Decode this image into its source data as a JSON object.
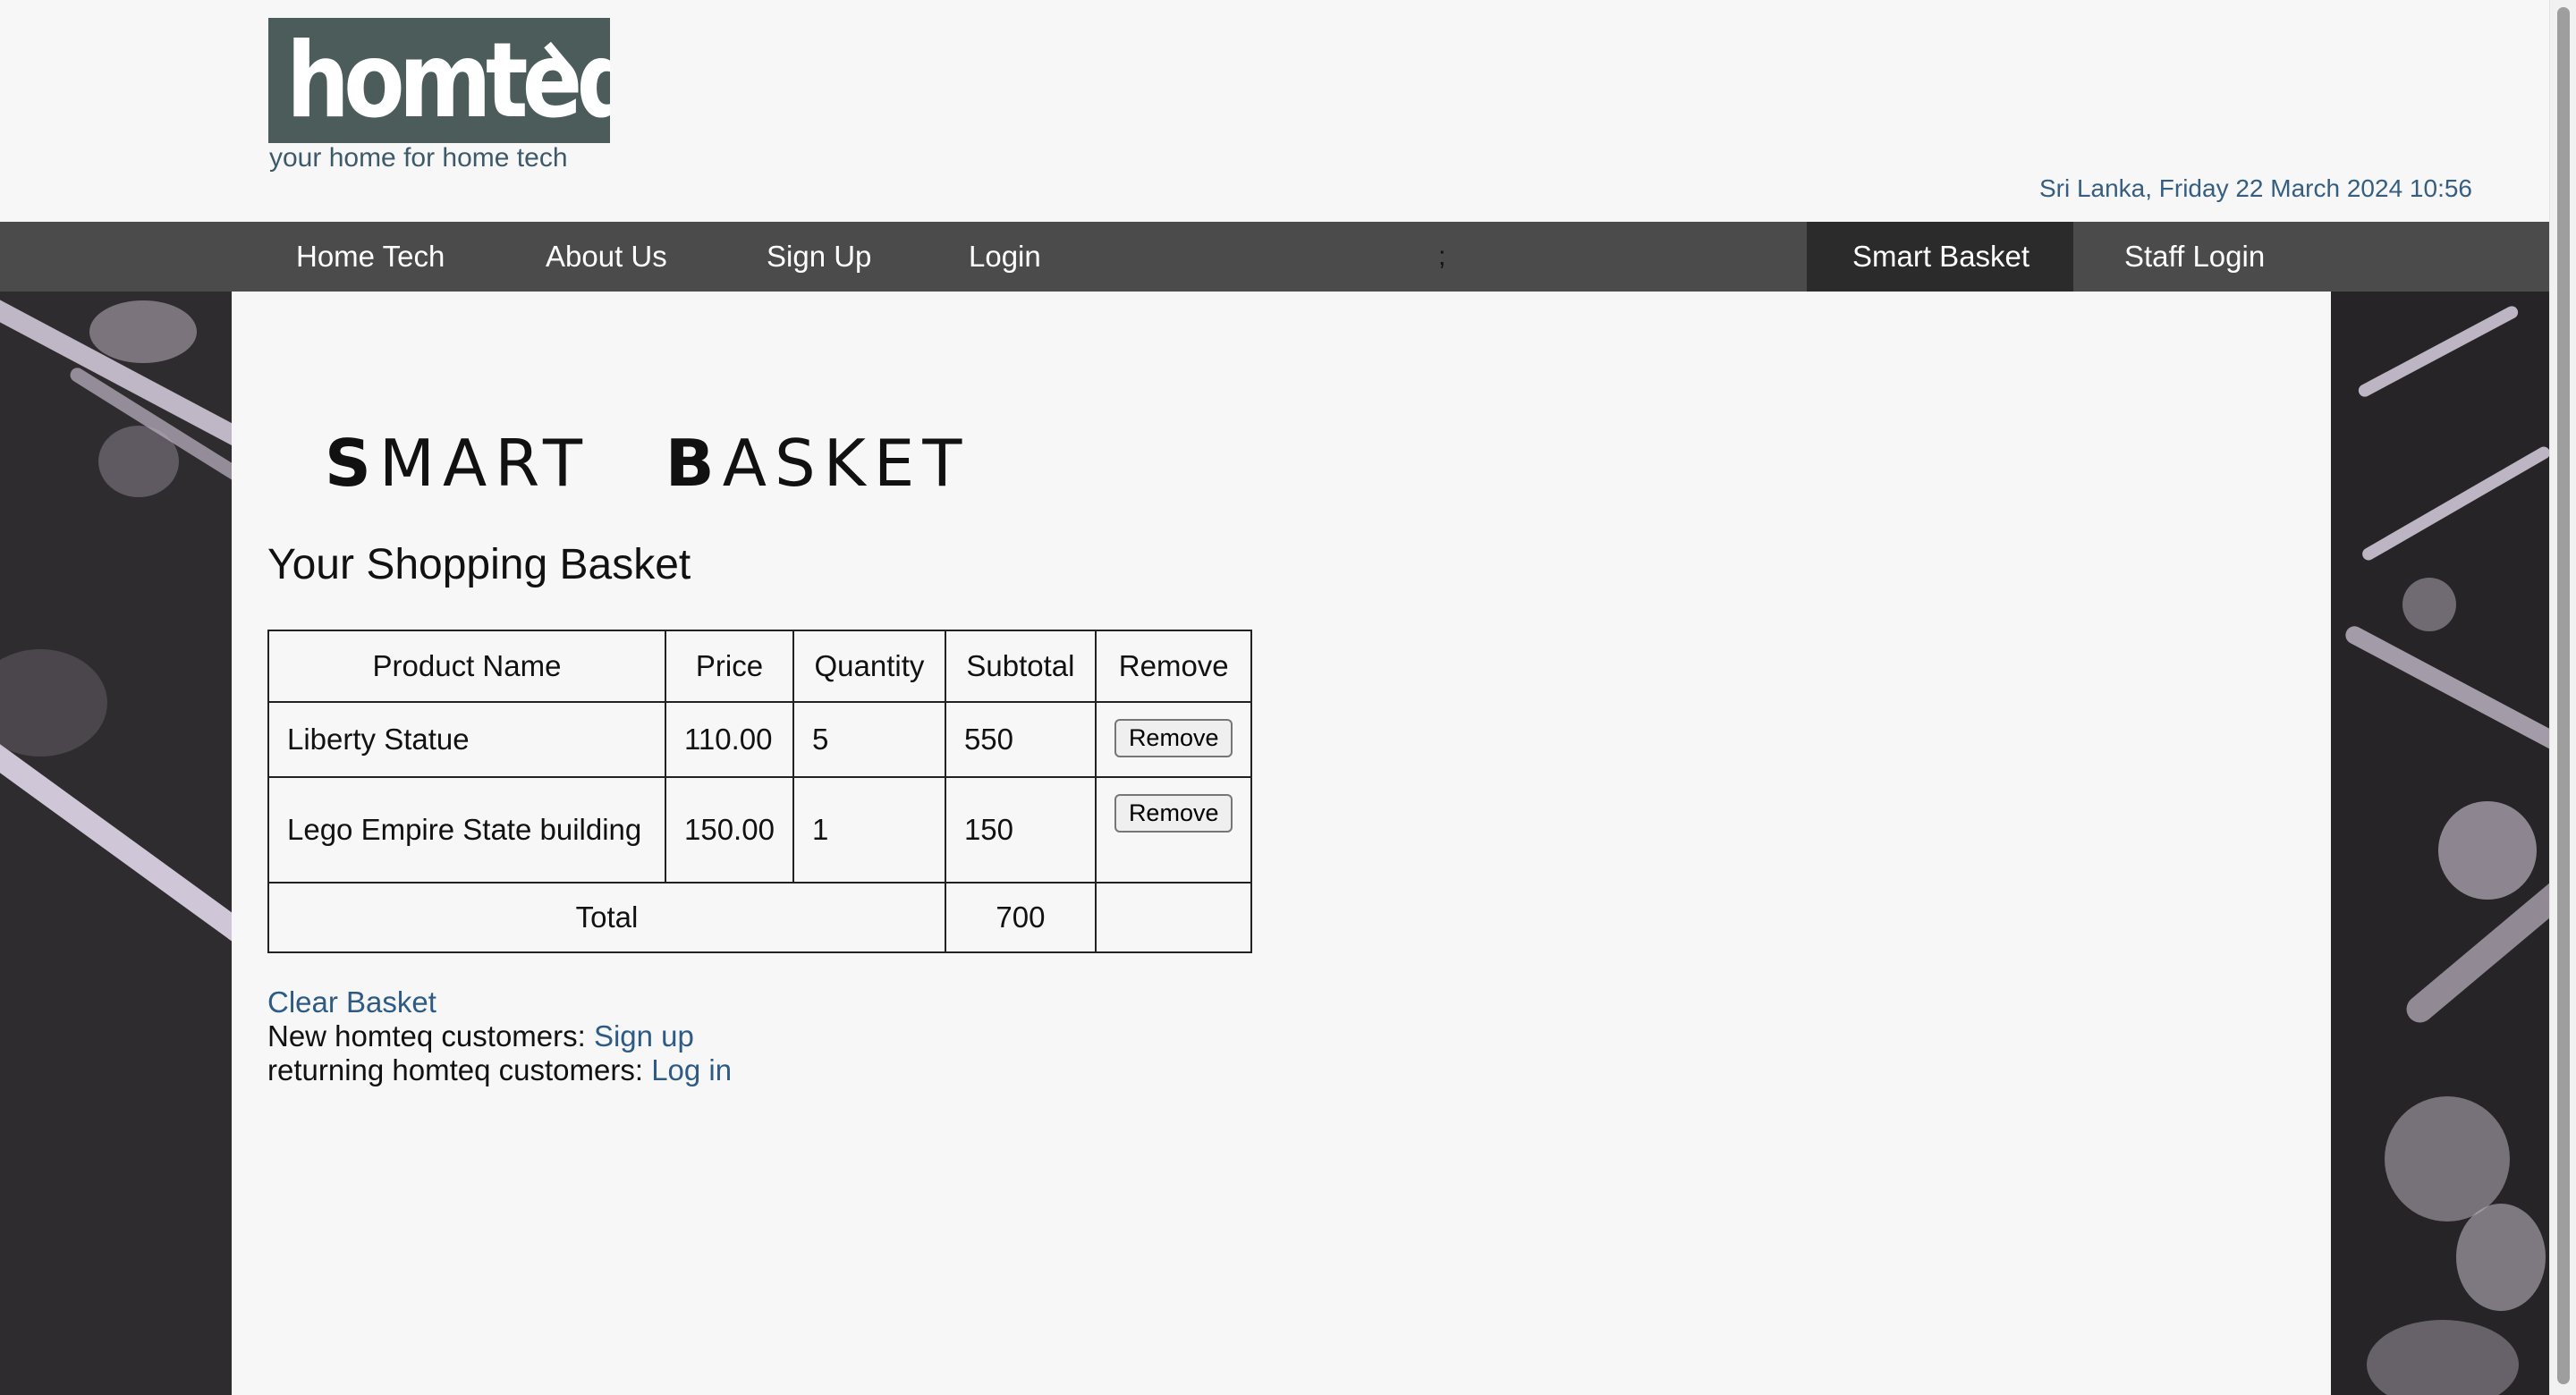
{
  "header": {
    "logo_text": "homteq",
    "tagline": "your home for home tech",
    "datetime": "Sri Lanka, Friday 22 March 2024 10:56"
  },
  "nav": {
    "items": [
      {
        "label": "Home Tech"
      },
      {
        "label": "About Us"
      },
      {
        "label": "Sign Up"
      },
      {
        "label": "Login"
      }
    ],
    "separator": ";",
    "right_items": [
      {
        "label": "Smart Basket",
        "active": true
      },
      {
        "label": "Staff Login",
        "active": false
      }
    ]
  },
  "page": {
    "title_words": [
      {
        "initial": "S",
        "rest": "MART"
      },
      {
        "initial": "B",
        "rest": "ASKET"
      }
    ],
    "heading": "Your Shopping Basket"
  },
  "basket": {
    "columns": [
      "Product Name",
      "Price",
      "Quantity",
      "Subtotal",
      "Remove"
    ],
    "rows": [
      {
        "product": "Liberty Statue",
        "price": "110.00",
        "quantity": "5",
        "subtotal": "550",
        "remove_label": "Remove"
      },
      {
        "product": "Lego Empire State building",
        "price": "150.00",
        "quantity": "1",
        "subtotal": "150",
        "remove_label": "Remove"
      }
    ],
    "total_label": "Total",
    "total_value": "700"
  },
  "links": {
    "clear_basket": "Clear Basket",
    "new_customers_text": "New homteq customers: ",
    "sign_up": "Sign up",
    "returning_customers_text": "returning homteq customers: ",
    "log_in": "Log in"
  },
  "colors": {
    "nav_bg": "#4b4b4b",
    "nav_active_bg": "#2b2b2b",
    "logo_bg": "#4b5c5b",
    "link": "#2d5b86",
    "datetime": "#355e80"
  }
}
